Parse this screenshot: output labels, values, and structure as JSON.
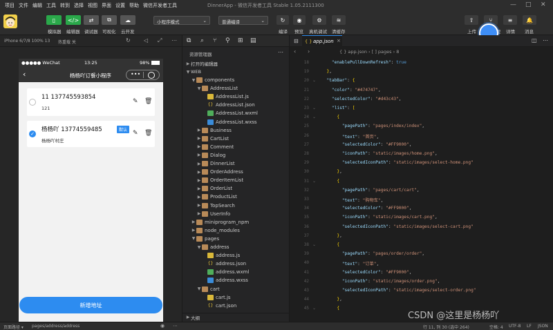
{
  "menu": [
    "项目",
    "文件",
    "编辑",
    "工具",
    "转到",
    "选择",
    "视图",
    "界面",
    "设置",
    "帮助",
    "微信开发者工具"
  ],
  "window_title": "DinnerApp - 微信开发者工具 Stable 1.05.2111300",
  "toolbar": {
    "simulator": "模拟器",
    "editor": "编辑器",
    "debugger": "调试器",
    "visual": "可视化",
    "cloud": "云开发",
    "mode_select": "小程序模式",
    "compile_select": "普通编译",
    "compile": "编译",
    "preview": "预览",
    "realdebug": "真机调试",
    "clearcache": "清缓存",
    "upload": "上传",
    "version": "版本管理",
    "details": "详情",
    "messages": "消息"
  },
  "sim": {
    "device": "iPhone 6/7/8 100% 13",
    "hot_reload": "热重载 关",
    "carrier": "●●●●● WeChat",
    "time": "13:25",
    "battery": "98%",
    "page_title": "杨杨吖订餐小程序",
    "addresses": [
      {
        "name": "11 137745593854",
        "addr": "121",
        "default": false
      },
      {
        "name": "杨杨吖 13774559485",
        "addr": "杨杨吖村庄",
        "default": true,
        "tag": "默认"
      }
    ],
    "add_button": "新增地址"
  },
  "explorer": {
    "title": "资源管理器",
    "open_editors": "打开的编辑器",
    "root": "WEB",
    "outline": "大纲",
    "items": [
      {
        "label": "components",
        "type": "dir",
        "depth": 1,
        "open": true
      },
      {
        "label": "AddressList",
        "type": "dir",
        "depth": 2,
        "open": true
      },
      {
        "label": "AddressList.js",
        "type": "js",
        "depth": 3
      },
      {
        "label": "AddressList.json",
        "type": "json",
        "depth": 3
      },
      {
        "label": "AddressList.wxml",
        "type": "wxml",
        "depth": 3
      },
      {
        "label": "AddressList.wxss",
        "type": "wxss",
        "depth": 3
      },
      {
        "label": "Business",
        "type": "dir",
        "depth": 2
      },
      {
        "label": "CartList",
        "type": "dir",
        "depth": 2
      },
      {
        "label": "Comment",
        "type": "dir",
        "depth": 2
      },
      {
        "label": "Dialog",
        "type": "dir",
        "depth": 2
      },
      {
        "label": "DinnerList",
        "type": "dir",
        "depth": 2
      },
      {
        "label": "OrderAddress",
        "type": "dir",
        "depth": 2
      },
      {
        "label": "OrderItemList",
        "type": "dir",
        "depth": 2
      },
      {
        "label": "OrderList",
        "type": "dir",
        "depth": 2
      },
      {
        "label": "ProductList",
        "type": "dir",
        "depth": 2
      },
      {
        "label": "TopSearch",
        "type": "dir",
        "depth": 2
      },
      {
        "label": "UserInfo",
        "type": "dir",
        "depth": 2
      },
      {
        "label": "miniprogram_npm",
        "type": "dir",
        "depth": 1
      },
      {
        "label": "node_modules",
        "type": "dir",
        "depth": 1
      },
      {
        "label": "pages",
        "type": "dir",
        "depth": 1,
        "open": true
      },
      {
        "label": "address",
        "type": "dir",
        "depth": 2,
        "open": true
      },
      {
        "label": "address.js",
        "type": "js",
        "depth": 3
      },
      {
        "label": "address.json",
        "type": "json",
        "depth": 3
      },
      {
        "label": "address.wxml",
        "type": "wxml",
        "depth": 3
      },
      {
        "label": "address.wxss",
        "type": "wxss",
        "depth": 3
      },
      {
        "label": "cart",
        "type": "dir",
        "depth": 2,
        "open": true
      },
      {
        "label": "cart.js",
        "type": "js",
        "depth": 3
      },
      {
        "label": "cart.json",
        "type": "json",
        "depth": 3
      }
    ]
  },
  "editor": {
    "tab": "app.json",
    "breadcrumb": "{ } app.json › [ ] pages › 8",
    "first_line": 18,
    "lines": [
      "    \"enablePullDownRefresh\": true",
      "  },",
      "  \"tabBar\": {",
      "    \"color\": \"#474747\",",
      "    \"selectedColor\": \"#d43c43\",",
      "    \"list\": [",
      "      {",
      "        \"pagePath\": \"pages/index/index\",",
      "        \"text\": \"首页\",",
      "        \"selectedColor\": \"#FF9000\",",
      "        \"iconPath\": \"static/images/home.png\",",
      "        \"selectedIconPath\": \"static/images/select-home.png\"",
      "      },",
      "      {",
      "        \"pagePath\": \"pages/cart/cart\",",
      "        \"text\": \"购物车\",",
      "        \"selectedColor\": \"#FF9000\",",
      "        \"iconPath\": \"static/images/cart.png\",",
      "        \"selectedIconPath\": \"static/images/select-cart.png\"",
      "      },",
      "      {",
      "        \"pagePath\": \"pages/order/order\",",
      "        \"text\": \"订单\",",
      "        \"selectedColor\": \"#FF9000\",",
      "        \"iconPath\": \"static/images/order.png\",",
      "        \"selectedIconPath\": \"static/images/select-order.png\"",
      "      },",
      "      {"
    ]
  },
  "status": {
    "page_path_label": "页面路径 ▾",
    "page_path": "pages/address/address",
    "cursor": "行 11, 列 30 (选中 264)",
    "spaces": "空格: 4",
    "encoding": "UTF-8",
    "eol": "LF",
    "lang": "JSON"
  },
  "watermark": "CSDN @这里是杨杨吖"
}
